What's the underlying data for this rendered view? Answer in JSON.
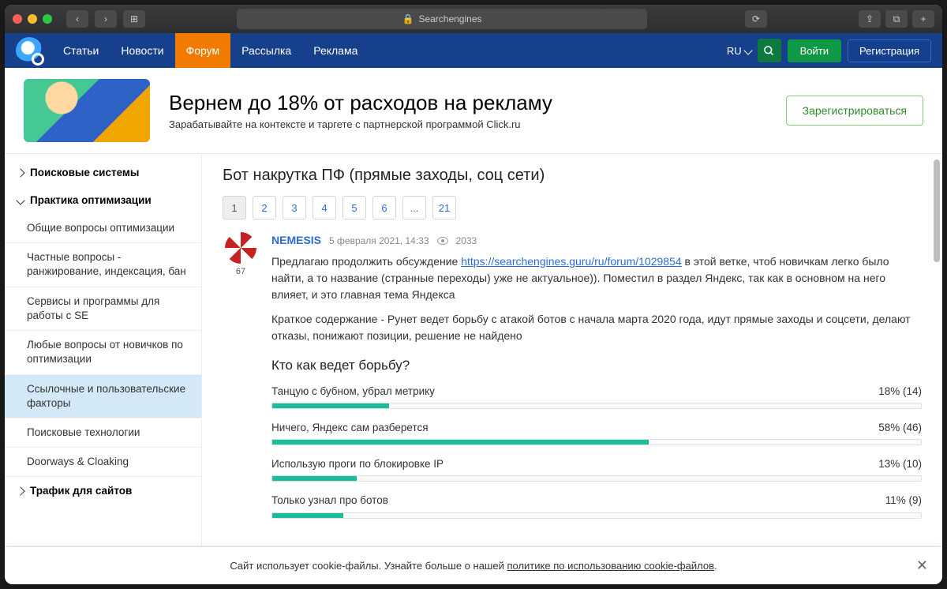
{
  "browser": {
    "title": "Searchengines"
  },
  "nav": {
    "items": [
      "Статьи",
      "Новости",
      "Форум",
      "Рассылка",
      "Реклама"
    ],
    "active_index": 2,
    "lang": "RU",
    "login": "Войти",
    "register": "Регистрация"
  },
  "banner": {
    "title": "Вернем до 18% от расходов на рекламу",
    "subtitle": "Зарабатывайте на контексте и таргете с партнерской программой Click.ru",
    "cta": "Зарегистрироваться"
  },
  "sidebar": {
    "groups": [
      {
        "label": "Поисковые системы",
        "open": false
      },
      {
        "label": "Практика оптимизации",
        "open": true,
        "items": [
          "Общие вопросы оптимизации",
          "Частные вопросы - ранжирование, индексация, бан",
          "Сервисы и программы для работы с SE",
          "Любые вопросы от новичков по оптимизации",
          "Ссылочные и пользовательские факторы",
          "Поисковые технологии",
          "Doorways & Cloaking"
        ],
        "selected_index": 4
      },
      {
        "label": "Трафик для сайтов",
        "open": false
      }
    ]
  },
  "thread": {
    "title": "Бот накрутка ПФ (прямые заходы, соц сети)",
    "pages": [
      "1",
      "2",
      "3",
      "4",
      "5",
      "6",
      "...",
      "21"
    ],
    "current_page_index": 0
  },
  "post": {
    "author": "NEMESIS",
    "karma": "67",
    "datetime": "5 февраля 2021, 14:33",
    "views": "2033",
    "link_text": "https://searchengines.guru/ru/forum/1029854",
    "p1a": "Предлагаю продолжить обсуждение ",
    "p1b": " в этой ветке, чтоб новичкам легко было найти, а то название (странные переходы) уже не актуальное)). Поместил в раздел Яндекс, так как в основном на него влияет, и это главная тема Яндекса",
    "p2": "Краткое содержание - Рунет ведет борьбу с атакой ботов с начала марта 2020 года, идут прямые заходы и соцсети, делают отказы, понижают позиции, решение не найдено"
  },
  "poll": {
    "title": "Кто как ведет борьбу?",
    "options": [
      {
        "label": "Танцую с бубном, убрал метрику",
        "pct": 18,
        "votes": 14
      },
      {
        "label": "Ничего, Яндекс сам разберется",
        "pct": 58,
        "votes": 46
      },
      {
        "label": "Использую проги по блокировке IP",
        "pct": 13,
        "votes": 10
      },
      {
        "label": "Только узнал про ботов",
        "pct": 11,
        "votes": 9
      }
    ]
  },
  "cookie": {
    "text_a": "Сайт использует cookie-файлы. Узнайте больше о нашей ",
    "link": "политике по использованию cookie-файлов",
    "text_b": "."
  },
  "chart_data": {
    "type": "bar",
    "title": "Кто как ведет борьбу?",
    "categories": [
      "Танцую с бубном, убрал метрику",
      "Ничего, Яндекс сам разберется",
      "Использую проги по блокировке IP",
      "Только узнал про ботов"
    ],
    "values": [
      18,
      58,
      13,
      11
    ],
    "counts": [
      14,
      46,
      10,
      9
    ],
    "xlabel": "",
    "ylabel": "%",
    "ylim": [
      0,
      100
    ]
  }
}
